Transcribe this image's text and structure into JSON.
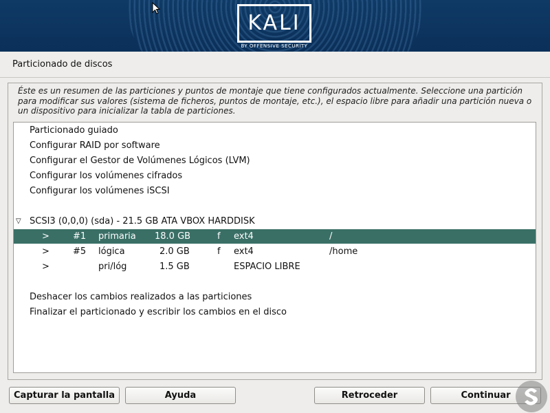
{
  "brand": {
    "name": "KALI",
    "tagline": "BY OFFENSIVE SECURITY"
  },
  "page": {
    "title": "Particionado de discos"
  },
  "help_text": "Éste es un resumen de las particiones y puntos de montaje que tiene configurados actualmente. Seleccione una partición para modificar sus valores (sistema de ficheros, puntos de montaje, etc.), el espacio libre para añadir una partición nueva o un dispositivo para inicializar la tabla de particiones.",
  "menu": {
    "guided": "Particionado guiado",
    "raid": "Configurar RAID por software",
    "lvm": "Configurar el Gestor de Volúmenes Lógicos (LVM)",
    "crypto": "Configurar los volúmenes cifrados",
    "iscsi": "Configurar los volúmenes iSCSI",
    "undo": "Deshacer los cambios realizados a las particiones",
    "finish": "Finalizar el particionado y escribir los cambios en el disco"
  },
  "disk": {
    "expander": "▽",
    "label": "SCSI3 (0,0,0) (sda) - 21.5 GB ATA VBOX HARDDISK",
    "partitions": [
      {
        "arrow": ">",
        "num": "#1",
        "type": "primaria",
        "size": "18.0 GB",
        "flag": "f",
        "fs": "ext4",
        "mount": "/",
        "selected": true
      },
      {
        "arrow": ">",
        "num": "#5",
        "type": "lógica",
        "size": "2.0 GB",
        "flag": "f",
        "fs": "ext4",
        "mount": "/home",
        "selected": false
      },
      {
        "arrow": ">",
        "num": "",
        "type": "pri/lóg",
        "size": "1.5 GB",
        "flag": "",
        "fs": "ESPACIO LIBRE",
        "mount": "",
        "selected": false
      }
    ]
  },
  "buttons": {
    "screenshot": "Capturar la pantalla",
    "help": "Ayuda",
    "back": "Retroceder",
    "continue": "Continuar"
  },
  "colors": {
    "banner": "#0f3a66",
    "selection": "#3a6f66",
    "background": "#eeedeb"
  }
}
